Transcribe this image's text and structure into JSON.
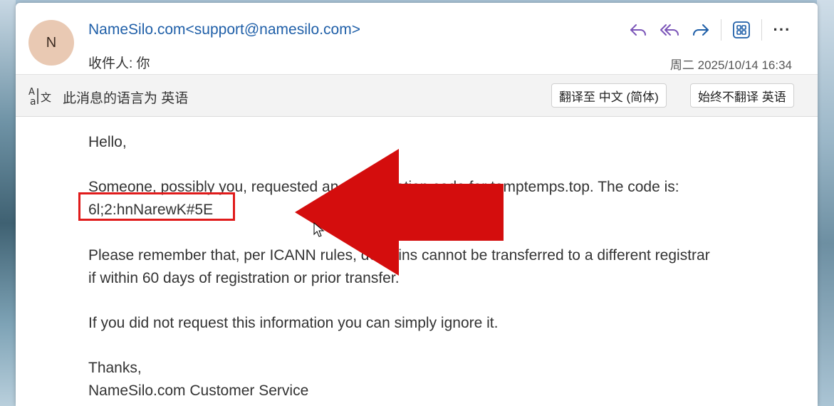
{
  "email": {
    "avatar_initial": "N",
    "sender": "NameSilo.com<support@namesilo.com>",
    "recipient": "收件人: 你",
    "datetime": "周二 2025/10/14 16:34"
  },
  "actions": {
    "reply_icon": "reply-icon",
    "reply_all_icon": "reply-all-icon",
    "forward_icon": "forward-icon",
    "apps_icon": "apps-grid-icon",
    "more_label": "···"
  },
  "translation": {
    "icon": "translate-icon",
    "message": "此消息的语言为 英语",
    "translate_button": "翻译至 中文 (简体)",
    "never_translate_button": "始终不翻译 英语"
  },
  "body": {
    "greeting": "Hello,",
    "para1_line1": "Someone, possibly you, requested an authorization code for temptemps.top. The code is:",
    "code": "6l;2:hnNarewK#5E",
    "para2_line1": "Please remember that, per ICANN rules, domains cannot be transferred to a different registrar",
    "para2_line2": "if within 60 days of registration or prior transfer.",
    "para3": "If you did not request this information you can simply ignore it.",
    "closing": "Thanks,",
    "signature": "NameSilo.com Customer Service"
  },
  "colors": {
    "accent": "#1f5fa8",
    "reply_purple": "#7b55b8",
    "annotation_red": "#e01b1b"
  }
}
